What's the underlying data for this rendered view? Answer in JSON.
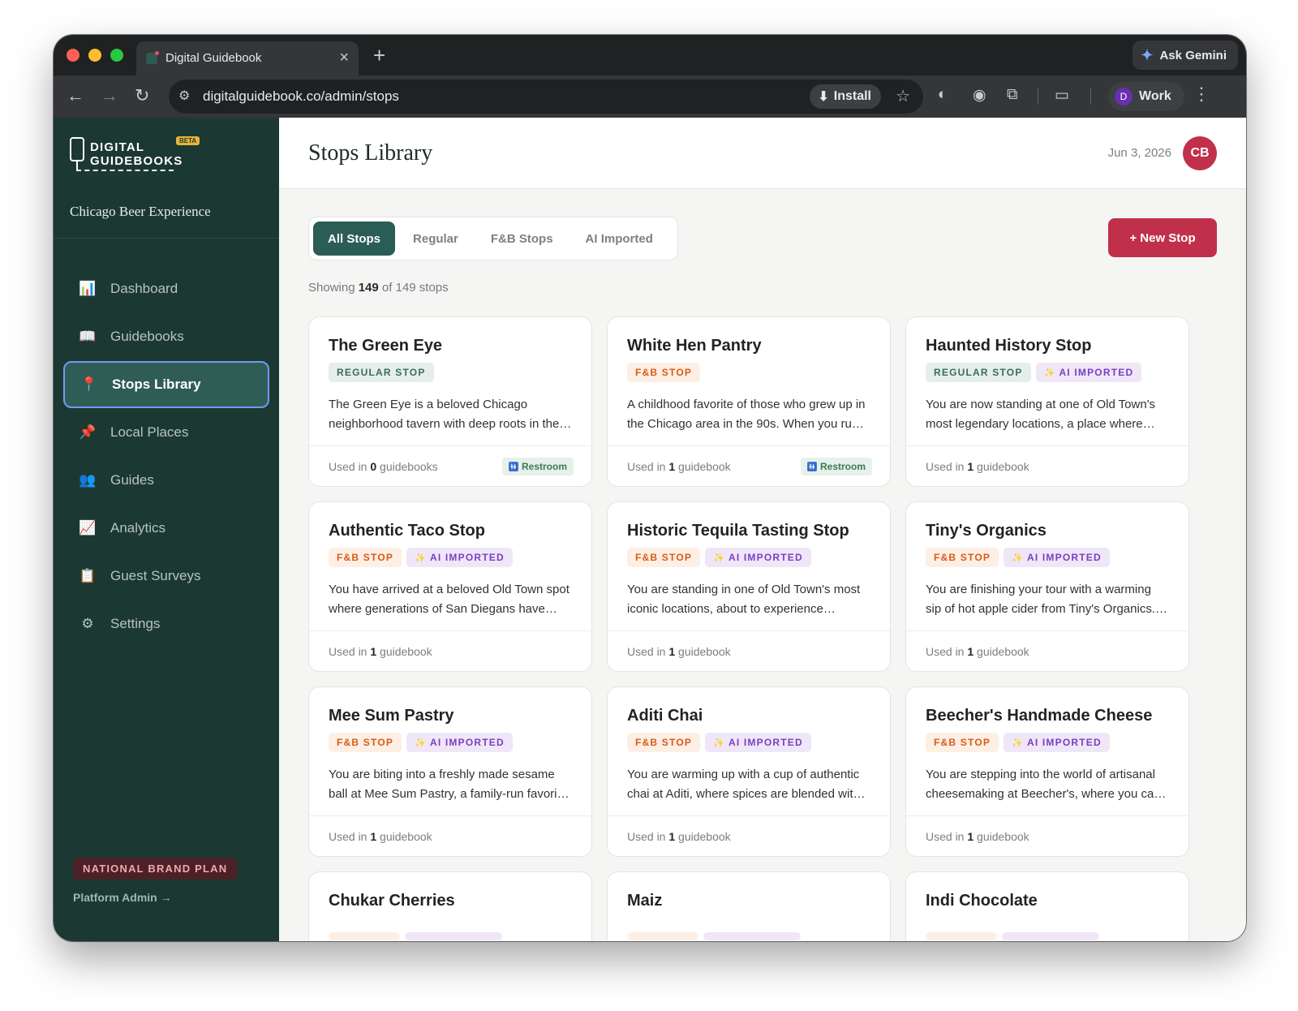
{
  "browser": {
    "tab_title": "Digital Guidebook",
    "url": "digitalguidebook.co/admin/stops",
    "install_label": "Install",
    "gemini_label": "Ask Gemini",
    "profile_initial": "D",
    "profile_label": "Work"
  },
  "sidebar": {
    "logo_line1": "DIGITAL",
    "logo_line2": "GUIDEBOOKS",
    "logo_badge": "BETA",
    "org_name": "Chicago Beer Experience",
    "items": [
      {
        "label": "Dashboard",
        "icon": "bar-chart-icon",
        "glyph": "📊"
      },
      {
        "label": "Guidebooks",
        "icon": "book-icon",
        "glyph": "📖"
      },
      {
        "label": "Stops Library",
        "icon": "pin-icon",
        "glyph": "📍"
      },
      {
        "label": "Local Places",
        "icon": "pushpin-icon",
        "glyph": "📌"
      },
      {
        "label": "Guides",
        "icon": "people-icon",
        "glyph": "👥"
      },
      {
        "label": "Analytics",
        "icon": "trend-chart-icon",
        "glyph": "📈"
      },
      {
        "label": "Guest Surveys",
        "icon": "clipboard-icon",
        "glyph": "📋"
      },
      {
        "label": "Settings",
        "icon": "gear-icon",
        "glyph": "⚙"
      }
    ],
    "active_index": 2,
    "plan_badge": "NATIONAL BRAND PLAN",
    "admin_link": "Platform Admin →"
  },
  "header": {
    "title": "Stops Library",
    "date": "Jun 3, 2026",
    "avatar_initials": "CB"
  },
  "filters": {
    "tabs": [
      "All Stops",
      "Regular",
      "F&B Stops",
      "AI Imported"
    ],
    "active_index": 0,
    "new_stop_label": "+ New Stop"
  },
  "summary": {
    "prefix": "Showing",
    "shown": "149",
    "middle": "of 149 stops"
  },
  "labels": {
    "regular_stop": "REGULAR STOP",
    "fnb_stop": "F&B STOP",
    "ai_imported": "AI IMPORTED",
    "used_in": "Used in",
    "restroom": "Restroom"
  },
  "colors": {
    "sidebar_bg": "#1c3832",
    "accent_green": "#2a5d55",
    "brand_red": "#c0304a"
  },
  "stops": [
    {
      "title": "The Green Eye",
      "badges": [
        "regular"
      ],
      "desc1": "The Green Eye is a beloved Chicago",
      "desc2": "neighborhood tavern with deep roots in the…",
      "used_count": "0",
      "used_unit": "guidebooks",
      "restroom": true
    },
    {
      "title": "White Hen Pantry",
      "badges": [
        "fnb"
      ],
      "desc1": "A childhood favorite of those who grew up in",
      "desc2": "the Chicago area in the 90s. When you ru…",
      "used_count": "1",
      "used_unit": "guidebook",
      "restroom": true
    },
    {
      "title": "Haunted History Stop",
      "badges": [
        "regular",
        "ai"
      ],
      "desc1": "You are now standing at one of Old Town's",
      "desc2": "most legendary locations, a place where…",
      "used_count": "1",
      "used_unit": "guidebook",
      "restroom": false
    },
    {
      "title": "Authentic Taco Stop",
      "badges": [
        "fnb",
        "ai"
      ],
      "desc1": "You have arrived at a beloved Old Town spot",
      "desc2": "where generations of San Diegans have…",
      "used_count": "1",
      "used_unit": "guidebook",
      "restroom": false
    },
    {
      "title": "Historic Tequila Tasting Stop",
      "badges": [
        "fnb",
        "ai"
      ],
      "desc1": "You are standing in one of Old Town's most",
      "desc2": "iconic locations, about to experience…",
      "used_count": "1",
      "used_unit": "guidebook",
      "restroom": false
    },
    {
      "title": "Tiny's Organics",
      "badges": [
        "fnb",
        "ai"
      ],
      "desc1": "You are finishing your tour with a warming",
      "desc2": "sip of hot apple cider from Tiny's Organics.…",
      "used_count": "1",
      "used_unit": "guidebook",
      "restroom": false
    },
    {
      "title": "Mee Sum Pastry",
      "badges": [
        "fnb",
        "ai"
      ],
      "desc1": "You are biting into a freshly made sesame",
      "desc2": "ball at Mee Sum Pastry, a family-run favori…",
      "used_count": "1",
      "used_unit": "guidebook",
      "restroom": false
    },
    {
      "title": "Aditi Chai",
      "badges": [
        "fnb",
        "ai"
      ],
      "desc1": "You are warming up with a cup of authentic",
      "desc2": "chai at Aditi, where spices are blended wit…",
      "used_count": "1",
      "used_unit": "guidebook",
      "restroom": false
    },
    {
      "title": "Beecher's Handmade Cheese",
      "badges": [
        "fnb",
        "ai"
      ],
      "desc1": "You are stepping into the world of artisanal",
      "desc2": "cheesemaking at Beecher's, where you ca…",
      "used_count": "1",
      "used_unit": "guidebook",
      "restroom": false
    },
    {
      "title": "Chukar Cherries",
      "badges": [],
      "desc1": "",
      "desc2": "",
      "used_count": "",
      "used_unit": "",
      "restroom": false
    },
    {
      "title": "Maiz",
      "badges": [],
      "desc1": "",
      "desc2": "",
      "used_count": "",
      "used_unit": "",
      "restroom": false
    },
    {
      "title": "Indi Chocolate",
      "badges": [],
      "desc1": "",
      "desc2": "",
      "used_count": "",
      "used_unit": "",
      "restroom": false
    }
  ]
}
